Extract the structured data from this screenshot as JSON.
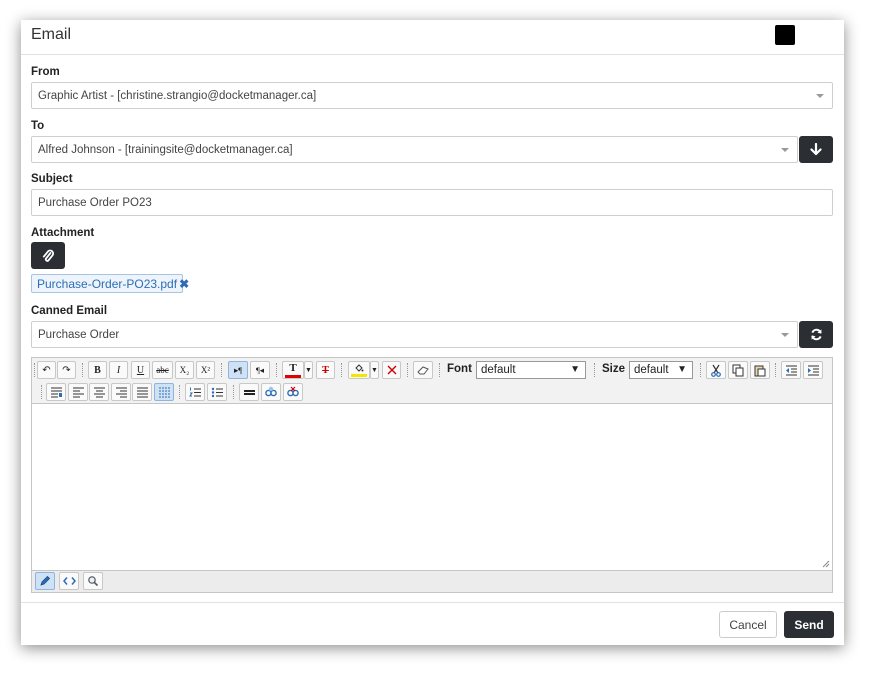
{
  "dialog": {
    "title": "Email"
  },
  "from": {
    "label": "From",
    "value": "Graphic Artist - [christine.strangio@docketmanager.ca]"
  },
  "to": {
    "label": "To",
    "value": "Alfred Johnson - [trainingsite@docketmanager.ca]"
  },
  "subject": {
    "label": "Subject",
    "value": "Purchase Order PO23"
  },
  "attachment": {
    "label": "Attachment",
    "file": "Purchase-Order-PO23.pdf",
    "remove": "✖"
  },
  "canned": {
    "label": "Canned Email",
    "value": "Purchase Order"
  },
  "toolbar": {
    "undo": "↶",
    "redo": "↷",
    "bold": "B",
    "italic": "I",
    "underline": "U",
    "strike": "abc",
    "subscript": "X₂",
    "superscript": "X²",
    "ltr": "▸¶",
    "rtl": "¶◂",
    "text_color": "T",
    "remove_color": "T",
    "font_label": "Font",
    "font_value": "default",
    "size_label": "Size",
    "size_value": "default",
    "select_arrow": "▼"
  },
  "footer": {
    "cancel": "Cancel",
    "send": "Send"
  },
  "colors": {
    "accent_dark": "#2b2f33",
    "chip_text": "#2d6db5",
    "text_color_bar": "#e00000",
    "highlight_bar": "#f3e600"
  }
}
